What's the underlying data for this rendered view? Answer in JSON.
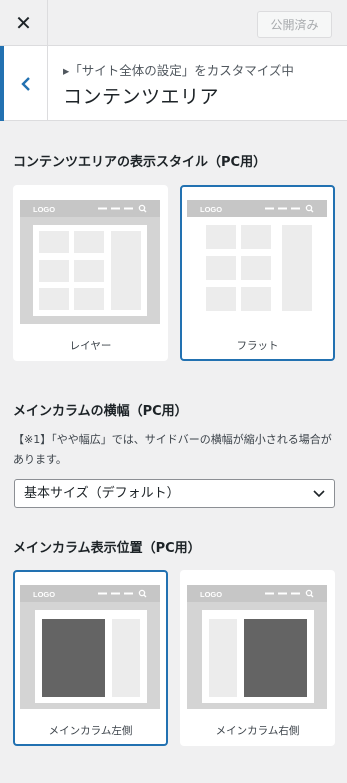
{
  "topbar": {
    "close_icon": "✕",
    "publish_label": "公開済み"
  },
  "section": {
    "breadcrumb": "▸「サイト全体の設定」をカスタマイズ中",
    "title": "コンテンツエリア"
  },
  "content_style": {
    "heading": "コンテンツエリアの表示スタイル（PC用）",
    "options": [
      {
        "label": "レイヤー",
        "selected": false,
        "logo": "LOGO"
      },
      {
        "label": "フラット",
        "selected": true,
        "logo": "LOGO"
      }
    ]
  },
  "main_width": {
    "heading": "メインカラムの横幅（PC用）",
    "note": "【※1】「やや幅広」では、サイドバーの横幅が縮小される場合があります。",
    "selected_value": "基本サイズ（デフォルト）"
  },
  "main_position": {
    "heading": "メインカラム表示位置（PC用）",
    "options": [
      {
        "label": "メインカラム左側",
        "selected": true,
        "logo": "LOGO"
      },
      {
        "label": "メインカラム右側",
        "selected": false,
        "logo": "LOGO"
      }
    ]
  },
  "colors": {
    "accent": "#2271b1",
    "thumb_frame": "#d4d4d4",
    "thumb_block": "#ececec",
    "main_column": "#646464"
  }
}
